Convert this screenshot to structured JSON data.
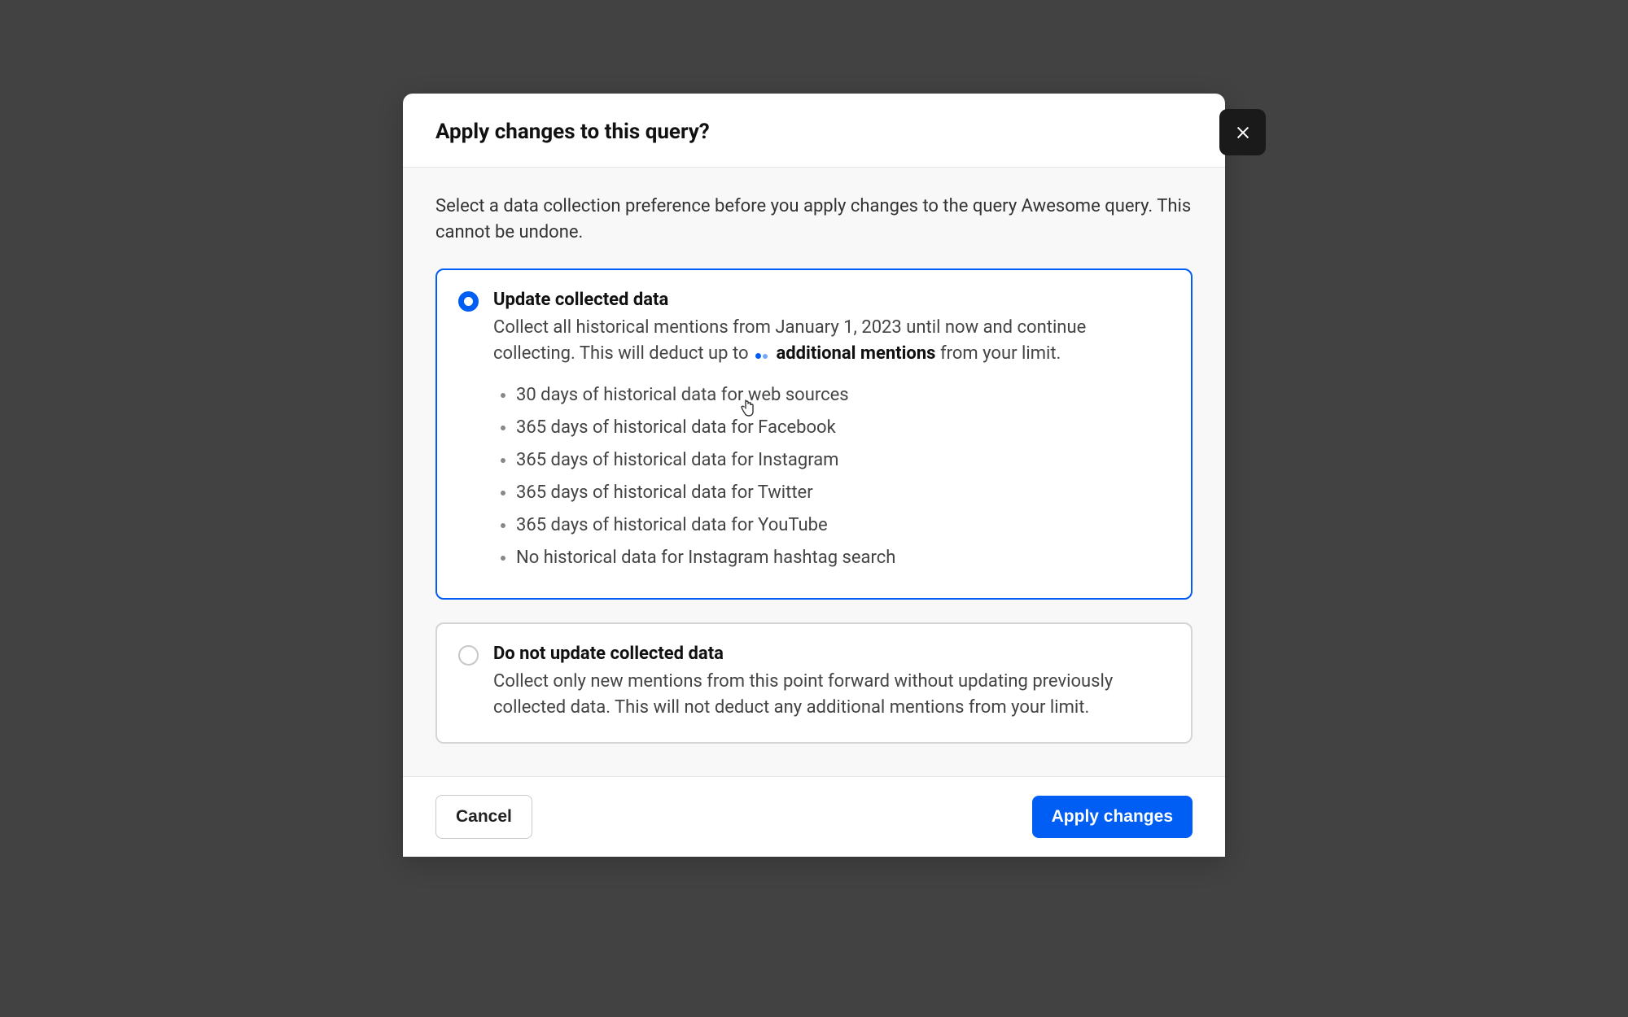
{
  "modal": {
    "title": "Apply changes to this query?",
    "intro": "Select a data collection preference before you apply changes to the query Awesome query. This cannot be undone.",
    "options": {
      "update": {
        "title": "Update collected data",
        "desc_prefix": "Collect all historical mentions from January 1, 2023 until now and continue collecting. This will deduct up to",
        "desc_bold": "additional mentions",
        "desc_suffix": "from your limit.",
        "items": [
          "30 days of historical data for web sources",
          "365 days of historical data for Facebook",
          "365 days of historical data for Instagram",
          "365 days of historical data for Twitter",
          "365 days of historical data for YouTube",
          "No historical data for Instagram hashtag search"
        ]
      },
      "noupdate": {
        "title": "Do not update collected data",
        "desc": "Collect only new mentions from this point forward without updating previously collected data. This will not deduct any additional mentions from your limit."
      }
    },
    "footer": {
      "cancel": "Cancel",
      "apply": "Apply changes"
    }
  }
}
